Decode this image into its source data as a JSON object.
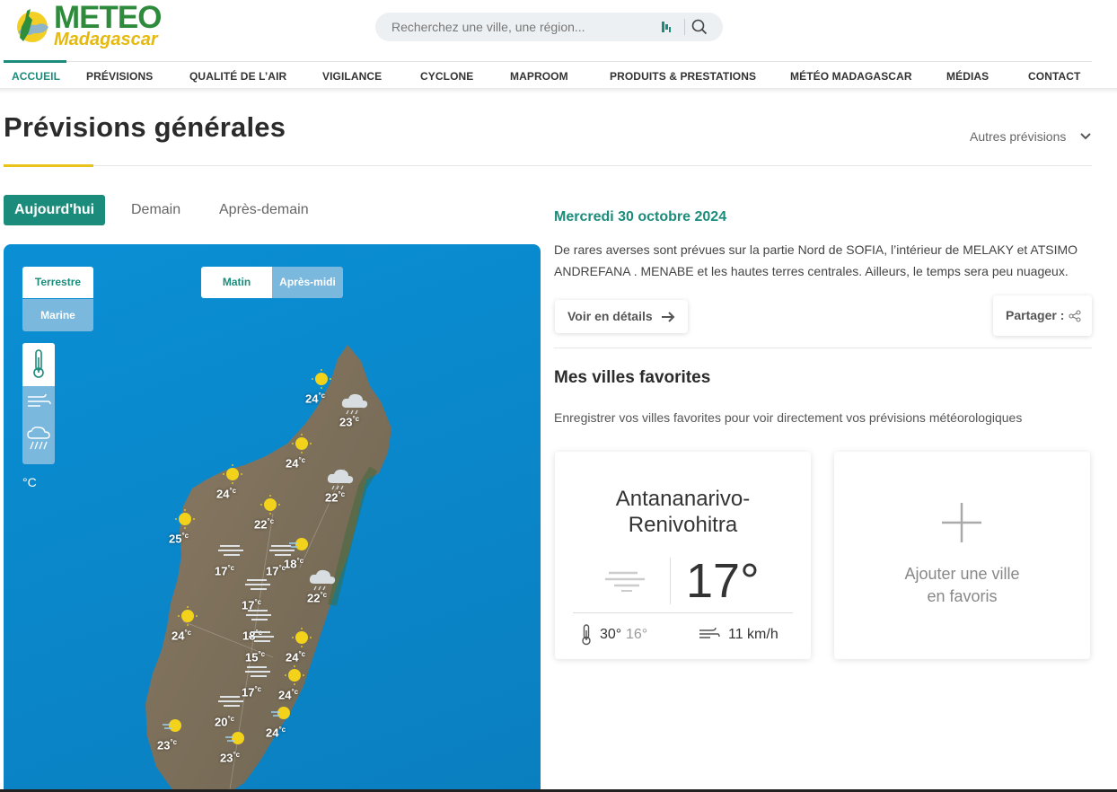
{
  "brand": {
    "line1": "METEO",
    "line2": "Madagascar"
  },
  "search": {
    "placeholder": "Recherchez une ville, une région..."
  },
  "nav": {
    "items": [
      {
        "label": "ACCUEIL"
      },
      {
        "label": "PRÉVISIONS"
      },
      {
        "label": "QUALITÉ DE L’AIR"
      },
      {
        "label": "VIGILANCE"
      },
      {
        "label": "CYCLONE"
      },
      {
        "label": "MAPROOM"
      },
      {
        "label": "PRODUITS & PRESTATIONS"
      },
      {
        "label": "MÉTÉO MADAGASCAR"
      },
      {
        "label": "MÉDIAS"
      },
      {
        "label": "CONTACT"
      }
    ]
  },
  "page": {
    "title": "Prévisions générales",
    "other_forecasts": "Autres prévisions"
  },
  "day_tabs": [
    {
      "label": "Aujourd'hui"
    },
    {
      "label": "Demain"
    },
    {
      "label": "Après-demain"
    }
  ],
  "map": {
    "terrestre": "Terrestre",
    "marine": "Marine",
    "matin": "Matin",
    "apres_midi": "Après-midi",
    "unit": "°C",
    "deg": "°c",
    "stations": [
      {
        "temp": "24",
        "icon": "sun"
      },
      {
        "temp": "23",
        "icon": "cloud-rain"
      },
      {
        "temp": "24",
        "icon": "sun"
      },
      {
        "temp": "24",
        "icon": "sun"
      },
      {
        "temp": "22",
        "icon": "cloud-rain"
      },
      {
        "temp": "22",
        "icon": "sun"
      },
      {
        "temp": "25",
        "icon": "sun"
      },
      {
        "temp": "17",
        "icon": "fog"
      },
      {
        "temp": "17",
        "icon": "fog"
      },
      {
        "temp": "18",
        "icon": "sun-wind"
      },
      {
        "temp": "22",
        "icon": "cloud-rain"
      },
      {
        "temp": "17",
        "icon": "fog"
      },
      {
        "temp": "18",
        "icon": "fog"
      },
      {
        "temp": "24",
        "icon": "sun"
      },
      {
        "temp": "15",
        "icon": "fog"
      },
      {
        "temp": "24",
        "icon": "sun"
      },
      {
        "temp": "17",
        "icon": "fog"
      },
      {
        "temp": "24",
        "icon": "sun"
      },
      {
        "temp": "20",
        "icon": "fog"
      },
      {
        "temp": "24",
        "icon": "sun-wind"
      },
      {
        "temp": "23",
        "icon": "sun-wind"
      },
      {
        "temp": "23",
        "icon": "sun-wind"
      }
    ]
  },
  "forecast": {
    "date": "Mercredi 30 octobre 2024",
    "text": "De rares averses sont prévues sur la partie Nord de SOFIA, l’intérieur de MELAKY et ATSIMO ANDREFANA . MENABE et  les hautes terres centrales. Ailleurs, le temps sera peu nuageux.",
    "details_label": "Voir en détails",
    "share_label": "Partager :"
  },
  "favorites": {
    "title": "Mes villes favorites",
    "desc": "Enregistrer vos villes favorites pour voir directement vos prévisions météorologiques",
    "city": {
      "name_line1": "Antananarivo-",
      "name_line2": "Renivohitra",
      "temp": "17°",
      "tmax": "30°",
      "tmin": "16°",
      "wind": "11 km/h",
      "icon": "fog"
    },
    "add": {
      "line1": "Ajouter une ville",
      "line2": "en favoris"
    }
  },
  "colors": {
    "accent": "#1b8c7b",
    "gold": "#e9c21c",
    "sea": "#0a86c9"
  }
}
